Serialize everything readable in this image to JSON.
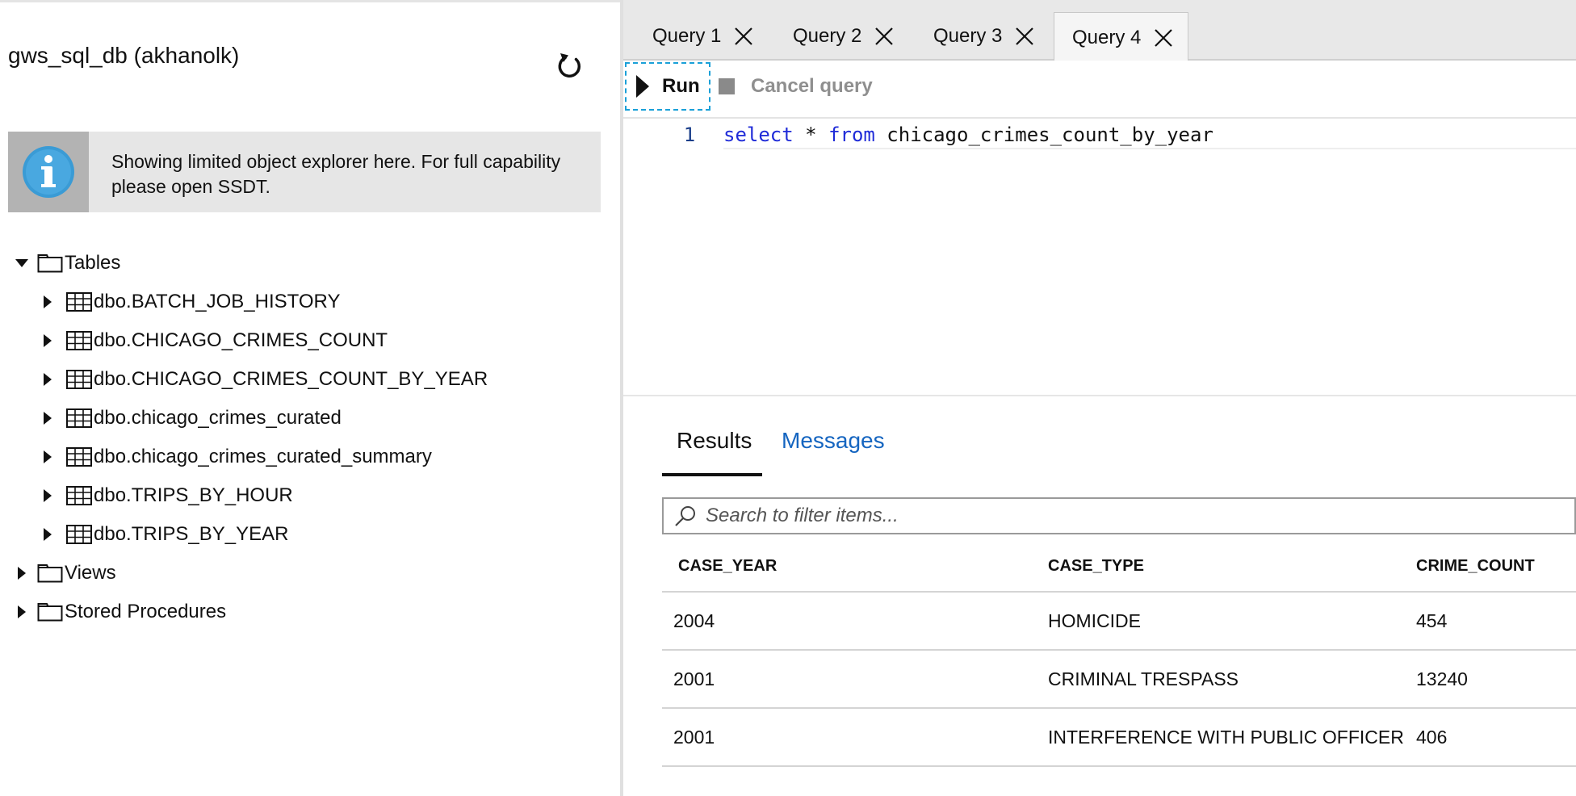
{
  "explorer": {
    "db_title": "gws_sql_db (akhanolk)",
    "refresh_icon": "refresh-icon",
    "info_banner": {
      "icon": "info-icon",
      "text": "Showing limited object explorer here. For full capability please open SSDT."
    },
    "tree": {
      "tables_label": "Tables",
      "tables": [
        "dbo.BATCH_JOB_HISTORY",
        "dbo.CHICAGO_CRIMES_COUNT",
        "dbo.CHICAGO_CRIMES_COUNT_BY_YEAR",
        "dbo.chicago_crimes_curated",
        "dbo.chicago_crimes_curated_summary",
        "dbo.TRIPS_BY_HOUR",
        "dbo.TRIPS_BY_YEAR"
      ],
      "views_label": "Views",
      "procedures_label": "Stored Procedures"
    }
  },
  "editor": {
    "tabs": [
      {
        "label": "Query 1",
        "active": false
      },
      {
        "label": "Query 2",
        "active": false
      },
      {
        "label": "Query 3",
        "active": false
      },
      {
        "label": "Query 4",
        "active": true
      }
    ],
    "toolbar": {
      "run_label": "Run",
      "cancel_label": "Cancel query"
    },
    "code": {
      "line_number": "1",
      "kw_select": "select",
      "star": " * ",
      "kw_from": "from",
      "table": " chicago_crimes_count_by_year"
    }
  },
  "results": {
    "tabs": {
      "results_label": "Results",
      "messages_label": "Messages"
    },
    "search_placeholder": "Search to filter items...",
    "columns": [
      "CASE_YEAR",
      "CASE_TYPE",
      "CRIME_COUNT"
    ],
    "rows": [
      [
        "2004",
        "HOMICIDE",
        "454"
      ],
      [
        "2001",
        "CRIMINAL TRESPASS",
        "13240"
      ],
      [
        "2001",
        "INTERFERENCE WITH PUBLIC OFFICER",
        "406"
      ]
    ]
  },
  "colors": {
    "keyword": "#1f2bd8",
    "link": "#1565c0",
    "focus_border": "#1aa0d8",
    "info_blue": "#3a9bd5"
  }
}
